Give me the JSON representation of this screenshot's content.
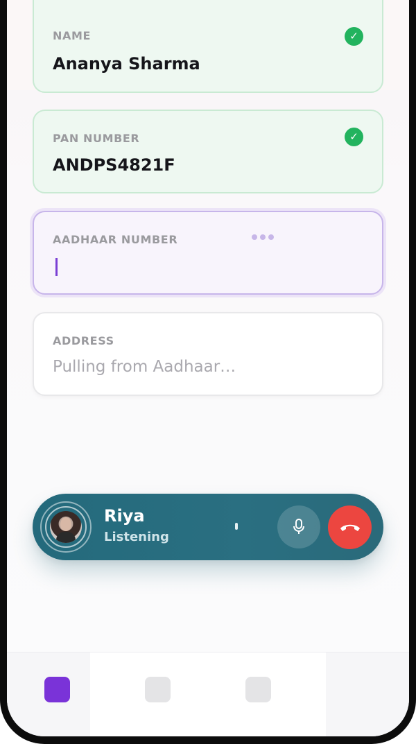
{
  "form": {
    "fields": [
      {
        "label": "NAME",
        "value": "Ananya Sharma",
        "state": "verified"
      },
      {
        "label": "PAN NUMBER",
        "value": "ANDPS4821F",
        "state": "verified"
      },
      {
        "label": "AADHAAR NUMBER",
        "value": "",
        "state": "typing"
      },
      {
        "label": "ADDRESS",
        "placeholder": "Pulling from Aadhaar…",
        "state": "pending"
      }
    ]
  },
  "call": {
    "agent_name": "Riya",
    "status": "Listening",
    "mic_icon": "microphone-icon",
    "end_icon": "phone-hangup-icon"
  },
  "nav": {
    "items": [
      {
        "name": "nav-item-1",
        "active": true
      },
      {
        "name": "nav-item-2",
        "active": false
      },
      {
        "name": "nav-item-3",
        "active": false
      }
    ]
  },
  "colors": {
    "accent": "#7a33d8",
    "verified": "#22b35e",
    "call_bar": "#246a7c",
    "end_call": "#ec4640"
  }
}
